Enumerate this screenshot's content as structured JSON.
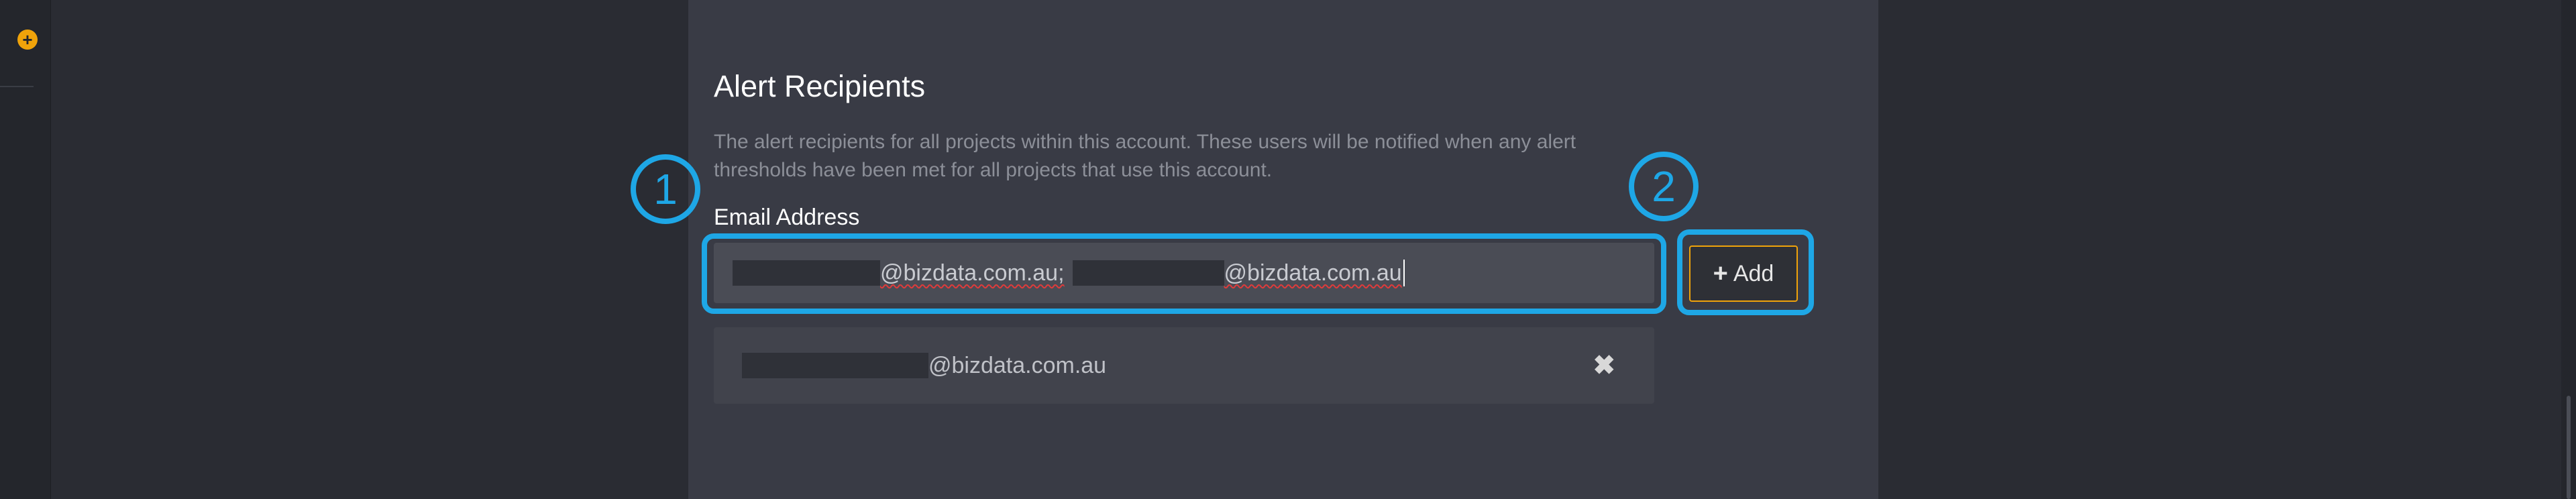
{
  "sidebar": {
    "add_icon_glyph": "+"
  },
  "alert_recipients": {
    "title": "Alert Recipients",
    "description": "The alert recipients for all projects within this account. These users will be notified when any alert thresholds have been met for all projects that use this account.",
    "email_label": "Email Address",
    "input": {
      "value_part1_domain": "@bizdata.com.au;",
      "value_part2_domain": "@bizdata.com.au"
    },
    "add_button_label": "Add",
    "recipients": [
      {
        "domain": "@bizdata.com.au"
      }
    ],
    "remove_glyph": "✖"
  },
  "annotations": {
    "marker1": "1",
    "marker2": "2"
  },
  "colors": {
    "accent": "#f0a30a",
    "annotation": "#1ea7e6",
    "panel": "#393b45",
    "background": "#2a2c33"
  }
}
